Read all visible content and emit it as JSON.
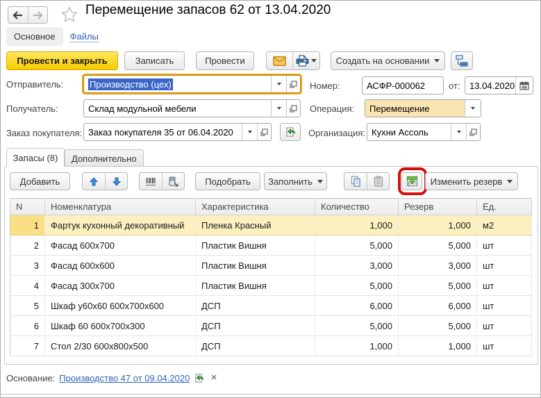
{
  "window": {
    "title": "Перемещение запасов 62 от 13.04.2020"
  },
  "nav_tabs": {
    "main": "Основное",
    "files": "Файлы"
  },
  "command_bar": {
    "post_and_close": "Провести и закрыть",
    "write": "Записать",
    "post": "Провести",
    "create_based_on": "Создать на основании"
  },
  "fields": {
    "sender": {
      "label": "Отправитель:",
      "value": "Производство (цех)"
    },
    "receiver": {
      "label": "Получатель:",
      "value": "Склад модульной мебели"
    },
    "customer_order": {
      "label": "Заказ покупателя:",
      "value": "Заказ покупателя 35 от 06.04.2020"
    },
    "number": {
      "label": "Номер:",
      "value": "АСФР-000062"
    },
    "date": {
      "label": "от:",
      "value": "13.04.2020"
    },
    "operation": {
      "label": "Операция:",
      "value": "Перемещение"
    },
    "organization": {
      "label": "Организация:",
      "value": "Кухни Ассоль"
    }
  },
  "detail_tabs": {
    "inventory": "Запасы (8)",
    "additional": "Дополнительно"
  },
  "table_toolbar": {
    "add": "Добавить",
    "pick": "Подобрать",
    "fill": "Заполнить",
    "change_reserve": "Изменить резерв"
  },
  "table": {
    "columns": [
      "N",
      "Номенклатура",
      "Характеристика",
      "Количество",
      "Резерв",
      "Ед."
    ],
    "rows": [
      {
        "n": "1",
        "item": "Фартук кухонный декоративный",
        "feature": "Пленка Красный",
        "qty": "1,000",
        "reserve": "1,000",
        "unit": "м2",
        "selected": true
      },
      {
        "n": "2",
        "item": "Фасад 600х700",
        "feature": "Пластик Вишня",
        "qty": "5,000",
        "reserve": "5,000",
        "unit": "шт",
        "selected": false
      },
      {
        "n": "3",
        "item": "Фасад 600х600",
        "feature": "Пластик Вишня",
        "qty": "3,000",
        "reserve": "3,000",
        "unit": "шт",
        "selected": false
      },
      {
        "n": "4",
        "item": "Фасад 300х700",
        "feature": "Пластик Вишня",
        "qty": "5,000",
        "reserve": "5,000",
        "unit": "шт",
        "selected": false
      },
      {
        "n": "5",
        "item": "Шкаф у60х60 600х700х600",
        "feature": "ДСП",
        "qty": "6,000",
        "reserve": "6,000",
        "unit": "шт",
        "selected": false
      },
      {
        "n": "6",
        "item": "Шкаф 60 600х700х300",
        "feature": "ДСП",
        "qty": "5,000",
        "reserve": "5,000",
        "unit": "шт",
        "selected": false
      },
      {
        "n": "7",
        "item": "Стол 2/30 600х800х500",
        "feature": "ДСП",
        "qty": "1,000",
        "reserve": "1,000",
        "unit": "шт",
        "selected": false
      }
    ]
  },
  "footer": {
    "label": "Основание:",
    "link": "Производство 47 от 09.04.2020"
  },
  "colors": {
    "accent_yellow": "#f8cb00",
    "focus_gold": "#e8a21d",
    "selection_blue": "#3a66c8",
    "operation_fill": "#fbe5b2",
    "row_highlight": "#fcf0c0",
    "link_blue": "#2d64bd",
    "annotation_red": "#cc1111"
  }
}
